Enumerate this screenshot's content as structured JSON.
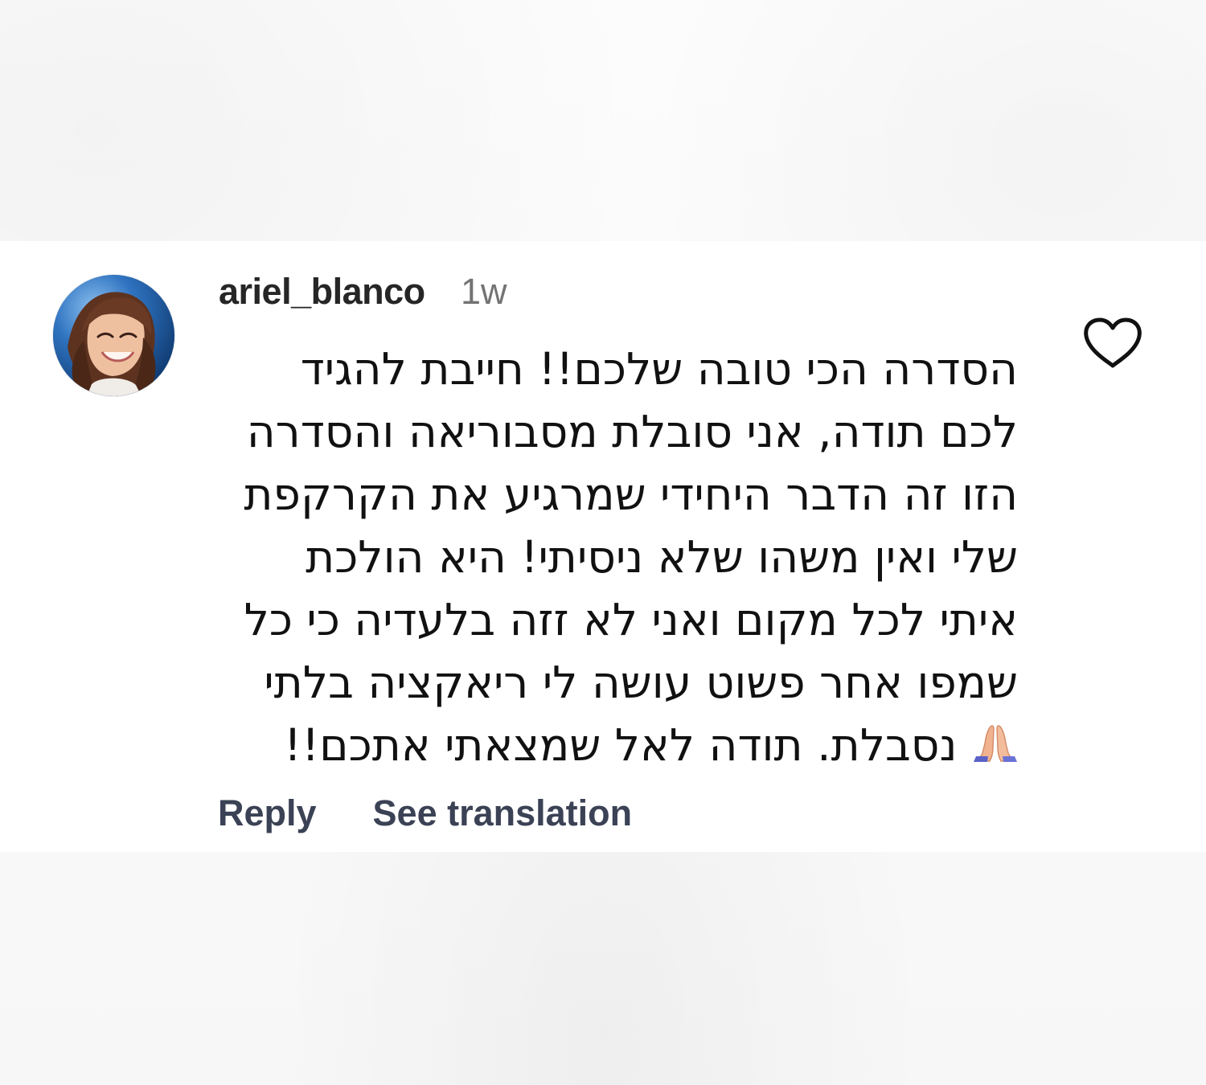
{
  "comment": {
    "avatar_icon": "profile-photo-avatar",
    "username": "ariel_blanco",
    "time_ago": "1w",
    "text_lines": [
      "הסדרה הכי טובה שלכם!! חייבת להגיד",
      "לכם תודה, אני סובלת מסבוריאה והסדרה",
      "הזו זה הדבר היחידי שמרגיע את הקרקפת",
      "שלי ואין משהו שלא ניסיתי! היא הולכת",
      "איתי לכל מקום ואני לא זזה בלעדיה כי כל",
      "שמפו אחר פשוט עושה לי ריאקציה בלתי",
      "נסבלת. תודה לאל שמצאתי אתכם!!"
    ],
    "emoji": "🙏",
    "actions": {
      "reply": "Reply",
      "translate": "See translation"
    },
    "like_icon": "heart-outline-icon",
    "colors": {
      "background": "#fbfbfb",
      "username": "#262626",
      "secondary_text": "#737373",
      "action_text": "#3b4255",
      "heart_outline": "#111111"
    }
  }
}
